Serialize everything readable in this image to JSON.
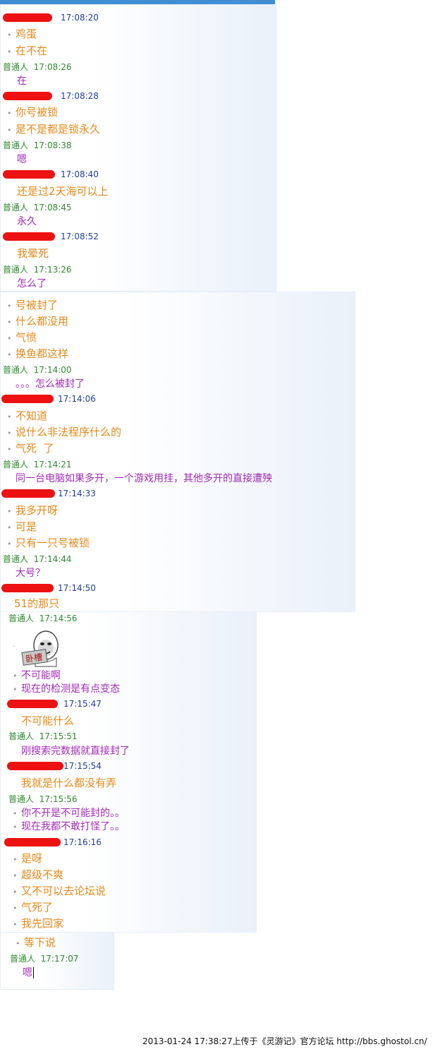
{
  "headers": [
    {
      "name": "",
      "time": "17:08:20",
      "me": false
    },
    {
      "name": "普通人",
      "time": "17:08:26",
      "me": true
    },
    {
      "name": "",
      "time": "17:08:28",
      "me": false
    },
    {
      "name": "普通人",
      "time": "17:08:38",
      "me": true
    },
    {
      "name": "",
      "time": "17:08:40",
      "me": false
    },
    {
      "name": "普通人",
      "time": "17:08:45",
      "me": true
    },
    {
      "name": "",
      "time": "17:08:52",
      "me": false
    },
    {
      "name": "普通人",
      "time": "17:13:26",
      "me": true
    },
    {
      "name": "普通人",
      "time": "17:14:00",
      "me": true
    },
    {
      "name": "",
      "time": "17:14:06",
      "me": false
    },
    {
      "name": "普通人",
      "time": "17:14:21",
      "me": true
    },
    {
      "name": "",
      "time": "17:14:33",
      "me": false
    },
    {
      "name": "普通人",
      "time": "17:14:44",
      "me": true
    },
    {
      "name": "",
      "time": "17:14:50",
      "me": false
    },
    {
      "name": "普通人",
      "time": "17:14:56",
      "me": true
    },
    {
      "name": "",
      "time": "17:15:47",
      "me": false
    },
    {
      "name": "普通人",
      "time": "17:15:51",
      "me": true
    },
    {
      "name": "",
      "time": "17:15:54",
      "me": false
    },
    {
      "name": "普通人",
      "time": "17:15:56",
      "me": true
    },
    {
      "name": "",
      "time": "17:16:16",
      "me": false
    },
    {
      "name": "普通人",
      "time": "17:17:07",
      "me": true
    }
  ],
  "messages": [
    "鸡蛋",
    "在不在",
    "在",
    "你号被锁",
    "是不是都是锁永久",
    "嗯",
    "还是过2天海可以上",
    "永久",
    "我晕死",
    "怎么了",
    "号被封了",
    "什么都没用",
    "气愤",
    "换鱼都这样",
    "。。。怎么被封了",
    "不知道",
    "说什么非法程序什么的",
    "气死  了",
    "同一台电脑如果多开，一个游戏用挂，其他多开的直接遭殃",
    "我多开呀",
    "可是",
    "只有一只号被锁",
    "大号？",
    "51的那只",
    "·",
    "不可能啊",
    "现在的检测是有点变态",
    "不可能什么",
    "刚搜索完数据就直接封了",
    "我就是什么都没有弄",
    "你不开是不可能封的。。",
    "现在我都不敢打怪了。。",
    "是呀",
    "超级不爽",
    "又不可以去论坛说",
    "气死了",
    "我先回家",
    "等下说",
    "嗯"
  ],
  "sticker": {
    "label": "卧槽",
    "icon": "meme-sticker-icon"
  },
  "footer": "2013-01-24 17:38:27上传于《灵游记》官方论坛 http://bbs.ghostol.cn/",
  "colors": {
    "them": "#e6891a",
    "me": "#a12bb5",
    "name": "#2d8b2d",
    "time": "#1f3f9a",
    "redact": "#ee1111"
  }
}
